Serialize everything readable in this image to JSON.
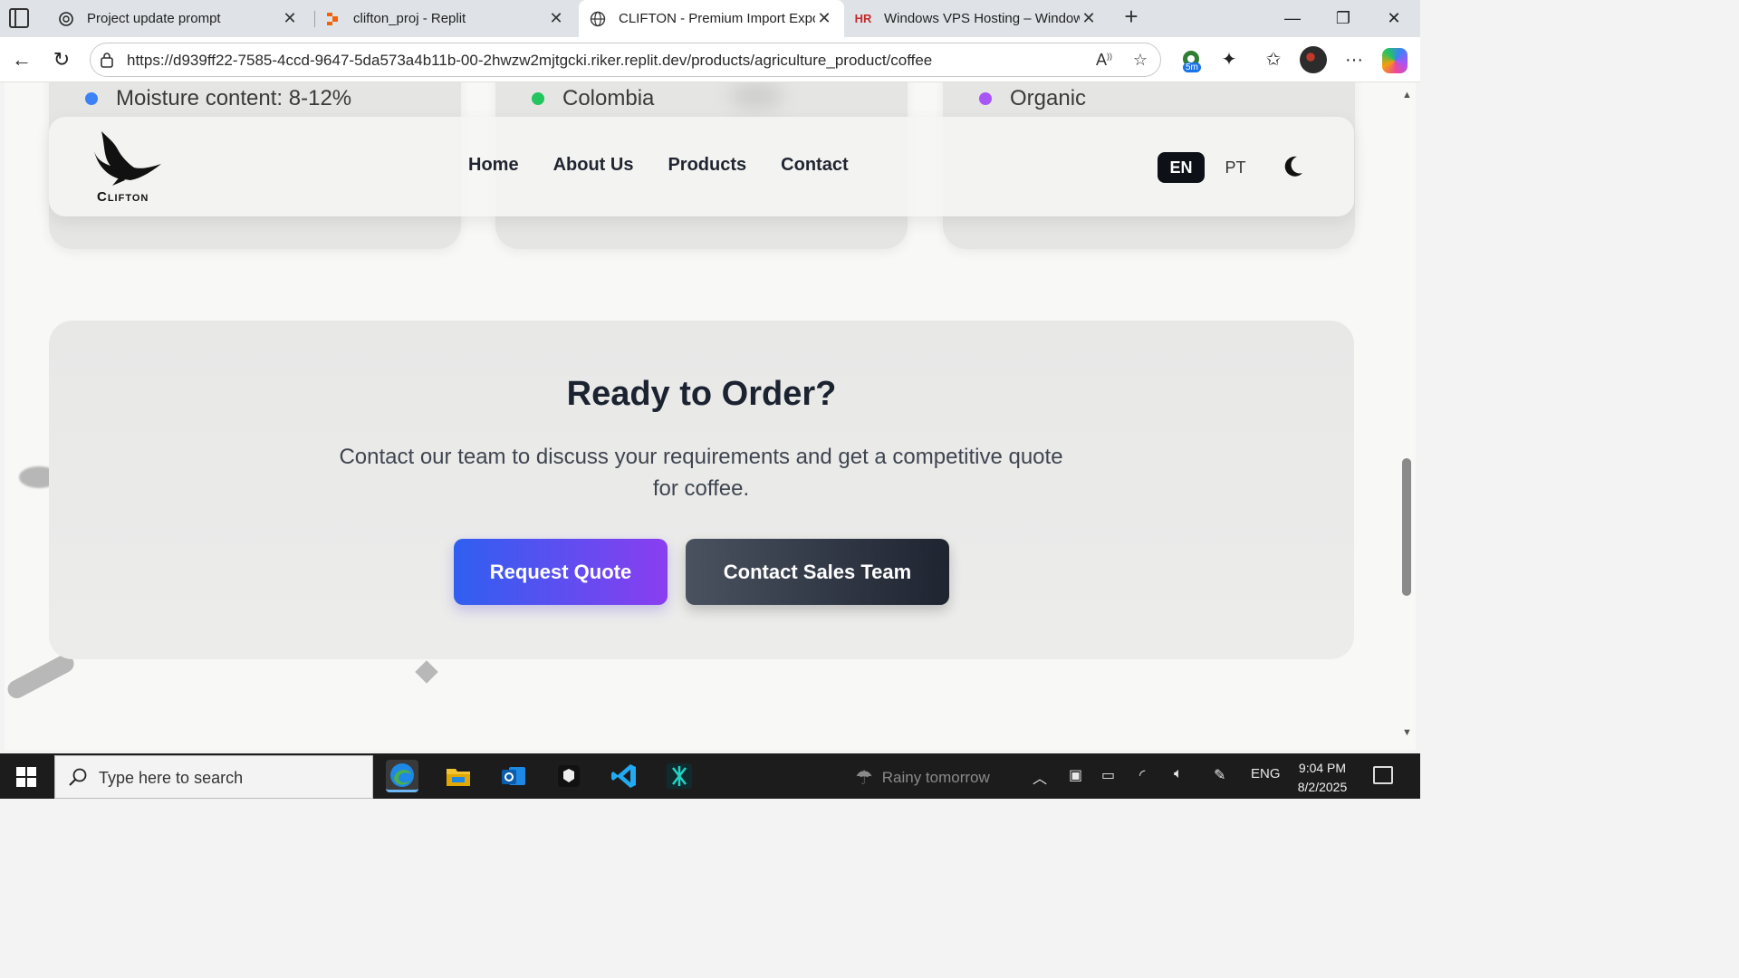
{
  "browser": {
    "tabs": [
      {
        "title": "Project update prompt",
        "icon": "chatgpt-icon",
        "active": false
      },
      {
        "title": "clifton_proj - Replit",
        "icon": "replit-icon",
        "active": false
      },
      {
        "title": "CLIFTON - Premium Import Expor",
        "icon": "globe-icon",
        "active": true
      },
      {
        "title": "Windows VPS Hosting – Windows",
        "icon": "hr-icon",
        "active": false
      }
    ],
    "url": "https://d939ff22-7585-4ccd-9647-5da573a4b11b-00-2hwzw2mjtgcki.riker.replit.dev/products/agriculture_product/coffee",
    "extension_badge": "5m"
  },
  "page": {
    "feature_cards": [
      {
        "text": "Moisture content: 8-12%",
        "dot_color": "#3b82f6"
      },
      {
        "text": "Colombia",
        "dot_color": "#22c55e"
      },
      {
        "text": "Organic",
        "dot_color": "#a855f7"
      }
    ],
    "nav": {
      "logo_text": "Clifton",
      "links": [
        "Home",
        "About Us",
        "Products",
        "Contact"
      ],
      "lang_active": "EN",
      "lang_other": "PT"
    },
    "cta": {
      "heading": "Ready to Order?",
      "description": "Contact our team to discuss your requirements and get a competitive quote for coffee.",
      "primary_button": "Request Quote",
      "secondary_button": "Contact Sales Team"
    }
  },
  "taskbar": {
    "search_placeholder": "Type here to search",
    "weather": "Rainy tomorrow",
    "language": "ENG",
    "time": "9:04 PM",
    "date": "8/2/2025"
  },
  "colors": {
    "primary_gradient_start": "#2f5ff0",
    "primary_gradient_end": "#8a3ef0",
    "secondary_dark": "#1e2430",
    "text_dark": "#1b2230"
  }
}
